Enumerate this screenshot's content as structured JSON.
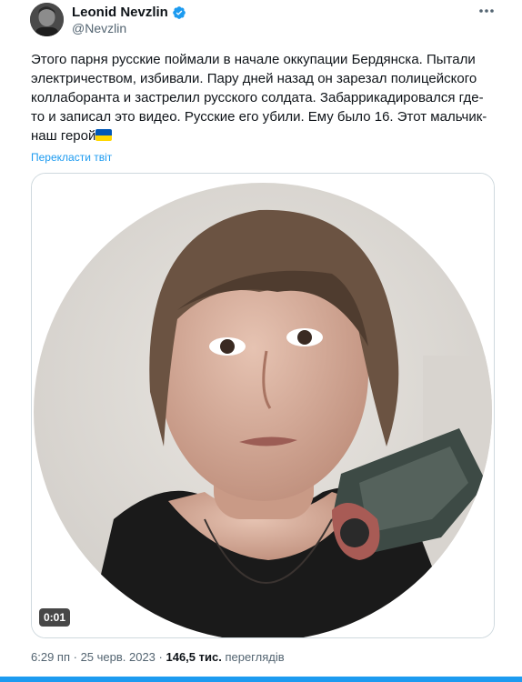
{
  "author": {
    "name": "Leonid Nevzlin",
    "handle": "@Nevzlin",
    "verified": true,
    "verified_color": "#1d9bf0"
  },
  "more_icon": "more-horizontal-icon",
  "tweet": {
    "text": "Этого парня русские поймали в начале оккупации Бердянска. Пытали электричеством, избивали. Пару дней назад он зарезал полицейского коллаборанта и застрелил русского солдата. Забаррикадировался где-то и записал это видео. Русские его убили. Ему было 16. Этот мальчик- наш герой",
    "emoji": "ukraine-flag",
    "translate_label": "Перекласти твіт"
  },
  "media": {
    "type": "video",
    "duration": "0:01"
  },
  "meta": {
    "time": "6:29 пп",
    "separator": " · ",
    "date": "25 черв. 2023",
    "views_count": "146,5 тис.",
    "views_label": "переглядів"
  },
  "colors": {
    "link": "#1d9bf0",
    "secondary_text": "#536471",
    "flag_blue": "#0057b7",
    "flag_yellow": "#ffd700"
  }
}
